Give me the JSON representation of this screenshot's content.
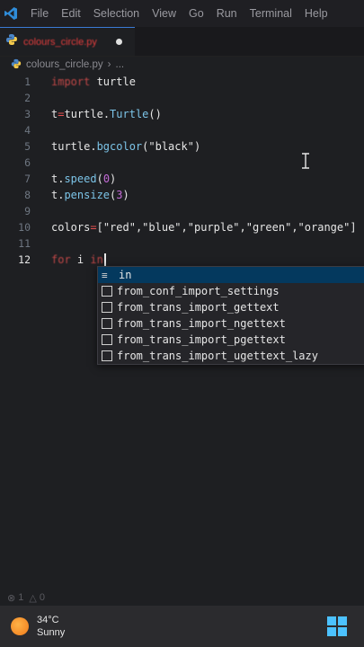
{
  "menubar": {
    "items": [
      "File",
      "Edit",
      "Selection",
      "View",
      "Go",
      "Run",
      "Terminal",
      "Help"
    ]
  },
  "tab": {
    "label": "colours_circle.py"
  },
  "breadcrumb": {
    "file": "colours_circle.py",
    "more": "..."
  },
  "editor": {
    "lines": [
      {
        "n": "1"
      },
      {
        "n": "2"
      },
      {
        "n": "3"
      },
      {
        "n": "4"
      },
      {
        "n": "5"
      },
      {
        "n": "6"
      },
      {
        "n": "7"
      },
      {
        "n": "8"
      },
      {
        "n": "9"
      },
      {
        "n": "10"
      },
      {
        "n": "11"
      },
      {
        "n": "12"
      }
    ],
    "code": {
      "l1_kw": "import",
      "l1_rest": " turtle",
      "l3_a": "t",
      "l3_op": "=",
      "l3_b": "turtle.",
      "l3_cls": "Turtle",
      "l3_c": "()",
      "l5_a": "turtle.",
      "l5_fn": "bgcolor",
      "l5_b": "(\"black\")",
      "l7_a": "t.",
      "l7_fn": "speed",
      "l7_b": "(",
      "l7_num": "0",
      "l7_c": ")",
      "l8_a": "t.",
      "l8_fn": "pensize",
      "l8_b": "(",
      "l8_num": "3",
      "l8_c": ")",
      "l10_a": "colors",
      "l10_op": "=",
      "l10_b": "[\"red\",\"blue\",\"purple\",\"green\",\"orange\"]",
      "l12_kw1": "for",
      "l12_mid": " i ",
      "l12_kw2": "in"
    }
  },
  "suggest": {
    "items": [
      {
        "label": "in"
      },
      {
        "label": "from_conf_import_settings"
      },
      {
        "label": "from_trans_import_gettext"
      },
      {
        "label": "from_trans_import_ngettext"
      },
      {
        "label": "from_trans_import_pgettext"
      },
      {
        "label": "from_trans_import_ugettext_lazy"
      }
    ]
  },
  "status": {
    "errors": "1",
    "warnings": "0"
  },
  "taskbar": {
    "temp": "34°C",
    "condition": "Sunny"
  },
  "colors": {
    "accent": "#3a7bd5",
    "keyword": "#c04747",
    "function": "#7cc4e8",
    "number": "#c46bd8"
  }
}
